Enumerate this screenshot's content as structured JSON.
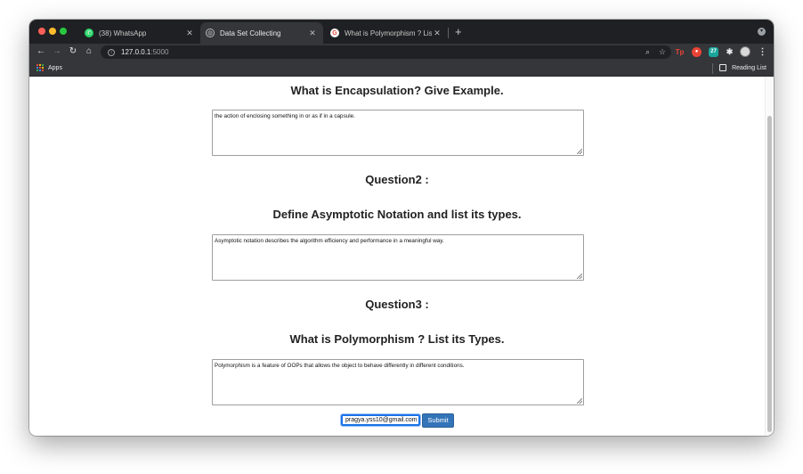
{
  "browser": {
    "tabs": [
      {
        "label": "(38) WhatsApp",
        "icon": "whatsapp-icon"
      },
      {
        "label": "Data Set Collecting",
        "icon": "globe-icon",
        "active": true
      },
      {
        "label": "What is Polymorphism ? List its Types",
        "icon": "google-icon"
      }
    ],
    "close_glyph": "✕",
    "new_tab_glyph": "+",
    "url_host": "127.0.0.1",
    "url_port": ":5000",
    "bookmarks": {
      "apps_label": "Apps",
      "reading_list_label": "Reading List"
    }
  },
  "page": {
    "question1_title": "What is Encapsulation? Give Example.",
    "answer1": "the action of enclosing something in or as if in a capsule.",
    "question2_label": "Question2 :",
    "question2_title": "Define Asymptotic Notation and list its types.",
    "answer2": "Asymptotic notation describes the algorithm efficiency and performance in a meaningful way.",
    "question3_label": "Question3 :",
    "question3_title": "What is Polymorphism ? List its Types.",
    "answer3": "Polymorphism is a feature of OOPs that allows the object to behave differently in different conditions.",
    "email_value": "pragya.yss10@gmail.com",
    "submit_label": "Submit"
  },
  "colors": {
    "submit_bg": "#3374b8",
    "tabstrip_bg": "#1f2023",
    "toolbar_bg": "#35363a"
  }
}
